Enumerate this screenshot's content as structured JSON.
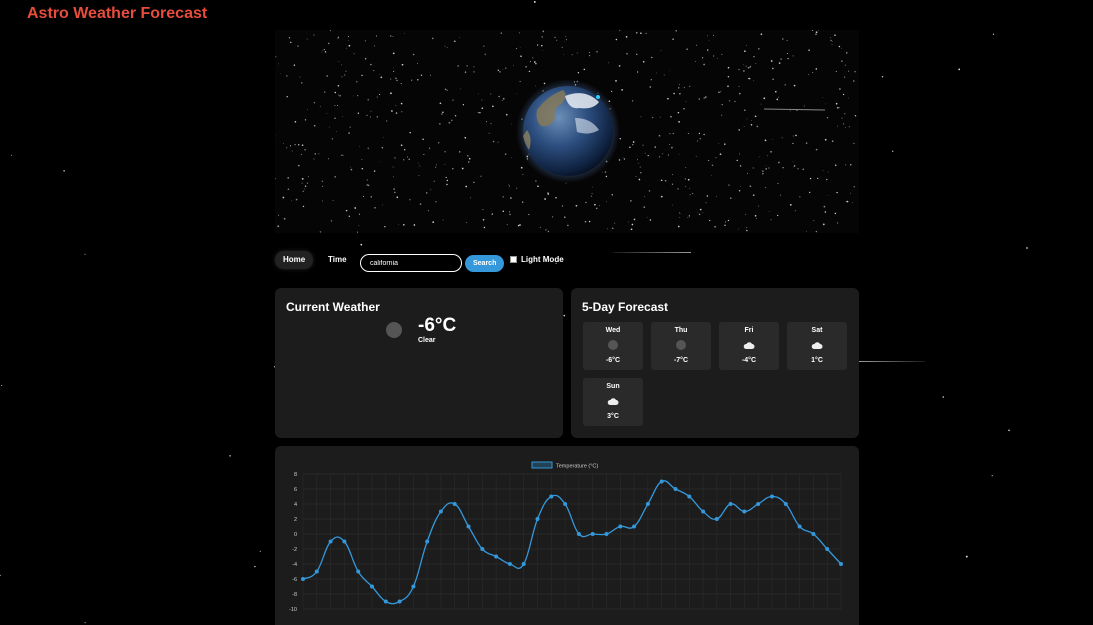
{
  "app": {
    "title": "Astro Weather Forecast"
  },
  "nav": {
    "home_label": "Home",
    "time_label": "Time"
  },
  "search": {
    "value": "california",
    "placeholder": "",
    "button_label": "Search"
  },
  "theme_toggle": {
    "label": "Light Mode",
    "checked": false
  },
  "current": {
    "title": "Current Weather",
    "temperature": "-6°C",
    "description": "Clear",
    "icon": "clear-icon"
  },
  "forecast": {
    "title": "5-Day Forecast",
    "days": [
      {
        "name": "Wed",
        "temp": "-6°C",
        "icon": "clear-icon"
      },
      {
        "name": "Thu",
        "temp": "-7°C",
        "icon": "clear-icon"
      },
      {
        "name": "Fri",
        "temp": "-4°C",
        "icon": "cloud-icon"
      },
      {
        "name": "Sat",
        "temp": "1°C",
        "icon": "cloud-icon"
      },
      {
        "name": "Sun",
        "temp": "3°C",
        "icon": "cloud-icon"
      }
    ]
  },
  "colors": {
    "accent": "#3498db",
    "title": "#e74c3c",
    "card": "#1c1c1c"
  },
  "chart_data": {
    "type": "line",
    "series": [
      {
        "name": "Temperature (°C)",
        "values": [
          -6,
          -5,
          -1,
          -1,
          -5,
          -7,
          -9,
          -9,
          -7,
          -1,
          3,
          4,
          1,
          -2,
          -3,
          -4,
          -4,
          2,
          5,
          4,
          0,
          0,
          0,
          1,
          1,
          4,
          7,
          6,
          5,
          3,
          2,
          4,
          3,
          4,
          5,
          4,
          1,
          0,
          -2,
          -4
        ]
      }
    ],
    "ylim": [
      -10,
      8
    ],
    "yticks": [
      8,
      6,
      4,
      2,
      0,
      -2,
      -4,
      -6,
      -8,
      -10
    ],
    "legend": "top",
    "grid": true
  }
}
